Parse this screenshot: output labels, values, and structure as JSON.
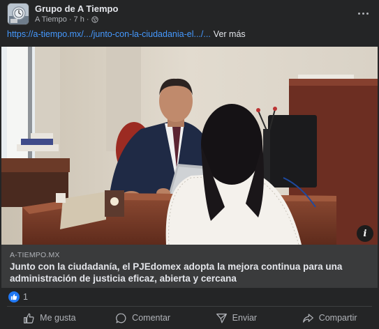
{
  "post": {
    "group_name": "Grupo de A Tiempo",
    "author": "A Tiempo",
    "separator": "·",
    "time": "7 h",
    "time_separator": "·",
    "more_icon": "more-horizontal-icon",
    "privacy_icon": "globe-icon"
  },
  "caption": {
    "link_text": "https://a-tiempo.mx/.../junto-con-la-ciudadania-el.../...",
    "see_more": "Ver más"
  },
  "link_preview": {
    "domain": "A-TIEMPO.MX",
    "title": "Junto con la ciudadanía, el PJEdomex adopta la mejora continua para una administración de justicia eficaz, abierta y cercana",
    "info_label": "i"
  },
  "reactions": {
    "count": "1",
    "icon": "like-icon"
  },
  "actions": {
    "like": "Me gusta",
    "comment": "Comentar",
    "send": "Enviar",
    "share": "Compartir"
  },
  "colors": {
    "background": "#242526",
    "link": "#4599ff",
    "like_badge": "#2078f4",
    "link_box": "#3a3b3c"
  }
}
